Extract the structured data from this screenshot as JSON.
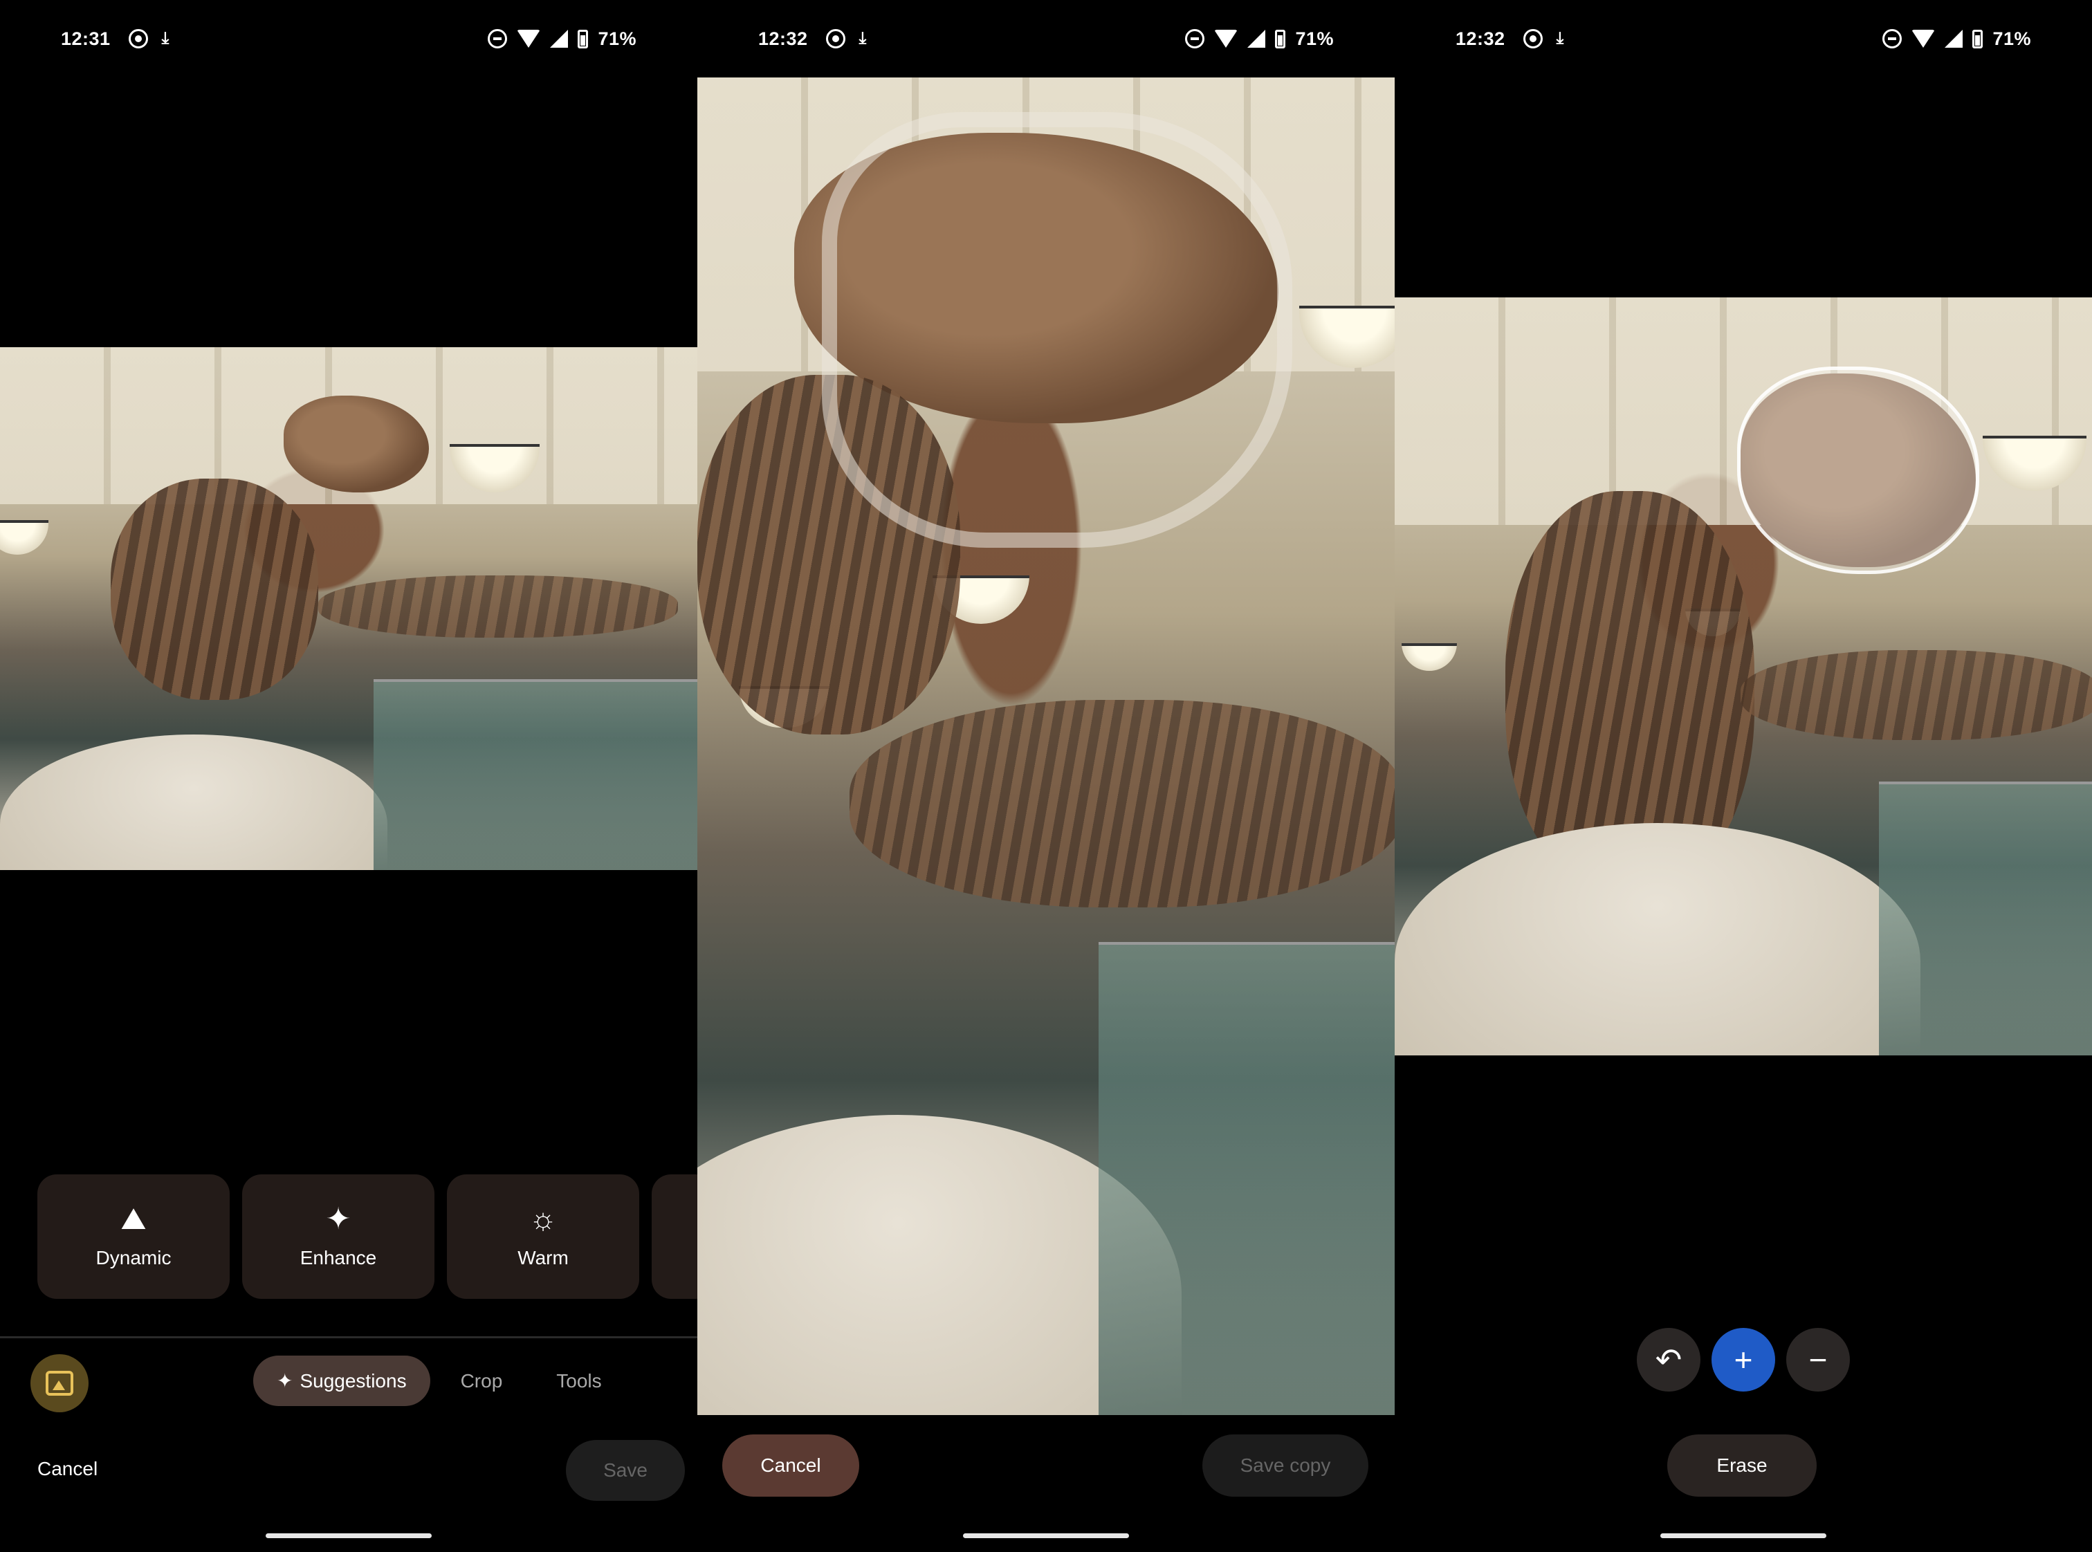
{
  "screens": [
    {
      "status": {
        "time": "12:31",
        "battery": "71%"
      },
      "suggestions": [
        {
          "label": "Dynamic",
          "icon": "mountain-icon"
        },
        {
          "label": "Enhance",
          "icon": "sparkle-icon"
        },
        {
          "label": "Warm",
          "icon": "sun-icon"
        }
      ],
      "tabs": [
        {
          "label": "Suggestions",
          "active": true
        },
        {
          "label": "Crop",
          "active": false
        },
        {
          "label": "Tools",
          "active": false
        }
      ],
      "cancel_label": "Cancel",
      "save_label": "Save"
    },
    {
      "status": {
        "time": "12:32",
        "battery": "71%"
      },
      "cancel_label": "Cancel",
      "save_copy_label": "Save copy"
    },
    {
      "status": {
        "time": "12:32",
        "battery": "71%"
      },
      "erase_label": "Erase",
      "controls": [
        "undo-icon",
        "add-icon",
        "remove-icon"
      ]
    }
  ],
  "colors": {
    "background": "#000000",
    "card_bg": "#231b18",
    "active_tab_bg": "#4a3a35",
    "cancel_pill_bg": "#5b3a32",
    "add_button_bg": "#1f5bc7"
  }
}
